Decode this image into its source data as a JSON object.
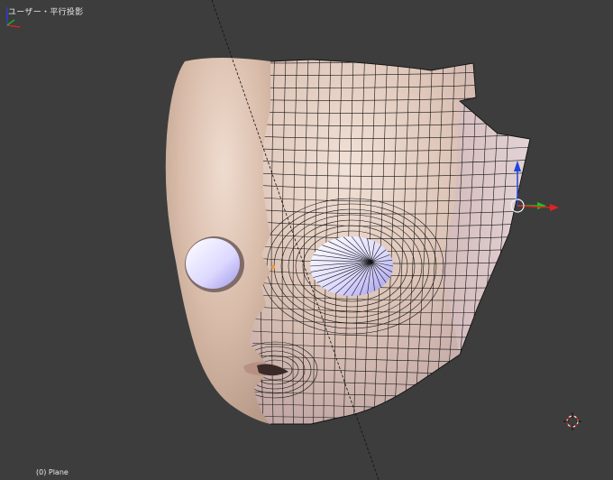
{
  "viewport": {
    "view_label": "ユーザー・平行投影",
    "object_label": "(0) Plane"
  },
  "icons": {
    "manipulator": "transform-manipulator-icon",
    "cursor": "3d-cursor-icon",
    "axes": "axis-orientation-icon"
  },
  "colors": {
    "background": "#3d3d3d",
    "skin": "#dcc0ae",
    "x_axis": "#e02020",
    "y_axis": "#20c020",
    "z_axis": "#2040e0"
  }
}
